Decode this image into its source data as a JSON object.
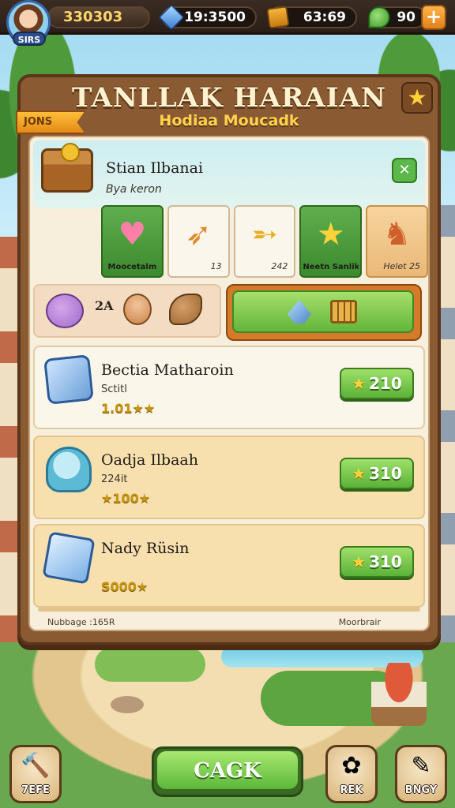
{
  "topbar": {
    "avatar_level": "SIRS",
    "coins": "330303",
    "gems": "19:3500",
    "boxes": "63:69",
    "leaves": "90",
    "plus_label": "+"
  },
  "panel": {
    "title": "TANLLAK HARAIAN",
    "subtitle": "Hodiaa Moucadk",
    "ribbon": "JONS",
    "star": "★"
  },
  "featured": {
    "title": "Stian Ilbanai",
    "subtitle": "Bya keron",
    "clover": "✕"
  },
  "tiles": [
    {
      "glyph": "♥",
      "label": "Moocetalm",
      "num": ""
    },
    {
      "glyph": "➶",
      "label": "",
      "num": "13"
    },
    {
      "glyph": "➵",
      "label": "",
      "num": "242"
    },
    {
      "glyph": "★",
      "label": "Neetn Sanlik",
      "num": ""
    },
    {
      "glyph": "♞",
      "label": "",
      "num": "Helet 25"
    }
  ],
  "pets": {
    "count": "2A"
  },
  "rewards": [
    {
      "name": "Bectia Matharoin",
      "sub": "Sctitl",
      "stars": "1.01★★",
      "cost": "210"
    },
    {
      "name": "Oadja Ilbaah",
      "sub": "224it",
      "stars": "★100★",
      "cost": "310"
    },
    {
      "name": "Nady Rüsin",
      "sub": "",
      "stars": "S000★",
      "cost": "310"
    }
  ],
  "footer": {
    "left": "Nubbage :165R",
    "right": "Moorbrair"
  },
  "bottom": {
    "back_label": "CAGK",
    "left_label": "7EFE",
    "mid_label": "REK",
    "right_label": "BNGY"
  }
}
